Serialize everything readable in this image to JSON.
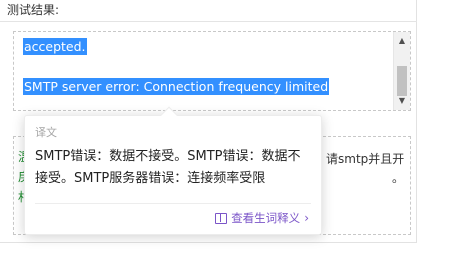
{
  "header": {
    "title": "测试结果:"
  },
  "result": {
    "line1": "accepted.",
    "line2": "SMTP server error: Connection frequency limited"
  },
  "second": {
    "left_top": "温",
    "left_mid": "戾",
    "left_bot": "村",
    "right_frag": "请smtp并且开",
    "right_frag2": "。"
  },
  "popup": {
    "label": "译文",
    "translation": "SMTP错误：数据不接受。SMTP错误：数据不接受。SMTP服务器错误：连接频率受限",
    "link": "查看生词释义",
    "link_icon": "book-icon",
    "chevron": "›"
  },
  "colors": {
    "selection": "#3390ff",
    "link": "#7b55c8"
  }
}
